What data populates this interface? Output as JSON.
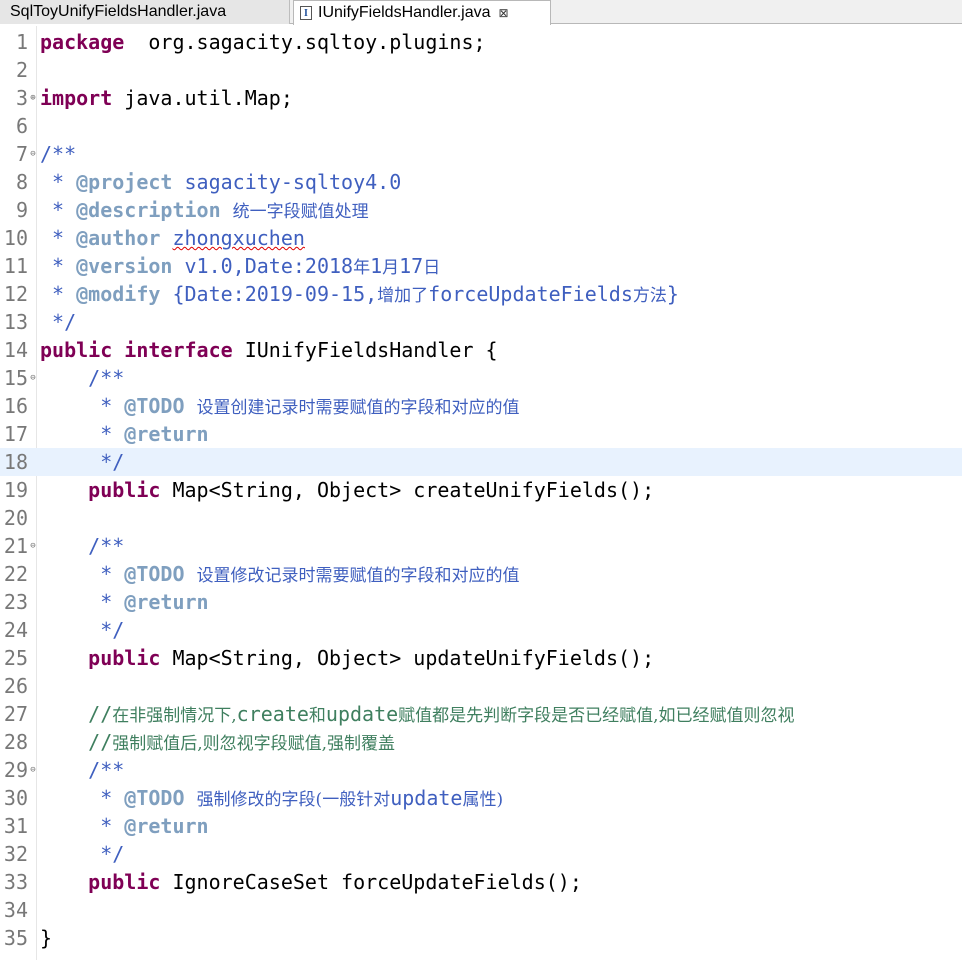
{
  "tabs": [
    {
      "label": "SqlToyUnifyFieldsHandler.java",
      "active": false
    },
    {
      "label": "IUnifyFieldsHandler.java",
      "active": true,
      "close_glyph": "⊠"
    }
  ],
  "editor": {
    "current_line": 18,
    "lines": [
      {
        "n": "1",
        "fold": "",
        "segs": [
          [
            "kw",
            "package"
          ],
          [
            "",
            "  org.sagacity.sqltoy.plugins;"
          ]
        ]
      },
      {
        "n": "2",
        "fold": "",
        "segs": []
      },
      {
        "n": "3",
        "fold": "⊕",
        "segs": [
          [
            "kw",
            "import"
          ],
          [
            "",
            " java.util.Map;"
          ]
        ]
      },
      {
        "n": "6",
        "fold": "",
        "segs": []
      },
      {
        "n": "7",
        "fold": "⊖",
        "segs": [
          [
            "jd",
            "/**"
          ]
        ]
      },
      {
        "n": "8",
        "fold": "",
        "segs": [
          [
            "jd",
            " * "
          ],
          [
            "tag",
            "@project"
          ],
          [
            "jd",
            " sagacity-sqltoy4.0"
          ]
        ]
      },
      {
        "n": "9",
        "fold": "",
        "segs": [
          [
            "jd",
            " * "
          ],
          [
            "tag",
            "@description"
          ],
          [
            "jd",
            " "
          ],
          [
            "jdzh",
            "统一字段赋值处理"
          ]
        ]
      },
      {
        "n": "10",
        "fold": "",
        "segs": [
          [
            "jd",
            " * "
          ],
          [
            "tag",
            "@author"
          ],
          [
            "jd",
            " "
          ],
          [
            "jdsq",
            "zhongxuchen"
          ]
        ]
      },
      {
        "n": "11",
        "fold": "",
        "segs": [
          [
            "jd",
            " * "
          ],
          [
            "tag",
            "@version"
          ],
          [
            "jd",
            " v1.0,Date:2018"
          ],
          [
            "jdzh",
            "年"
          ],
          [
            "jd",
            "1"
          ],
          [
            "jdzh",
            "月"
          ],
          [
            "jd",
            "17"
          ],
          [
            "jdzh",
            "日"
          ]
        ]
      },
      {
        "n": "12",
        "fold": "",
        "segs": [
          [
            "jd",
            " * "
          ],
          [
            "tag",
            "@modify"
          ],
          [
            "jd",
            " {Date:2019-09-15,"
          ],
          [
            "jdzh",
            "增加了"
          ],
          [
            "jd",
            "forceUpdateFields"
          ],
          [
            "jdzh",
            "方法"
          ],
          [
            "jd",
            "}"
          ]
        ]
      },
      {
        "n": "13",
        "fold": "",
        "segs": [
          [
            "jd",
            " */"
          ]
        ]
      },
      {
        "n": "14",
        "fold": "",
        "segs": [
          [
            "kw",
            "public"
          ],
          [
            "",
            " "
          ],
          [
            "kw",
            "interface"
          ],
          [
            "",
            " IUnifyFieldsHandler {"
          ]
        ]
      },
      {
        "n": "15",
        "fold": "⊖",
        "segs": [
          [
            "jd",
            "    /**"
          ]
        ]
      },
      {
        "n": "16",
        "fold": "",
        "segs": [
          [
            "jd",
            "     * "
          ],
          [
            "tag",
            "@TODO"
          ],
          [
            "jd",
            " "
          ],
          [
            "jdzh",
            "设置创建记录时需要赋值的字段和对应的值"
          ]
        ]
      },
      {
        "n": "17",
        "fold": "",
        "segs": [
          [
            "jd",
            "     * "
          ],
          [
            "tag",
            "@return"
          ]
        ]
      },
      {
        "n": "18",
        "fold": "",
        "segs": [
          [
            "jd",
            "     */"
          ]
        ]
      },
      {
        "n": "19",
        "fold": "",
        "segs": [
          [
            "",
            "    "
          ],
          [
            "kw",
            "public"
          ],
          [
            "",
            " Map<String, Object> createUnifyFields();"
          ]
        ]
      },
      {
        "n": "20",
        "fold": "",
        "segs": []
      },
      {
        "n": "21",
        "fold": "⊖",
        "segs": [
          [
            "jd",
            "    /**"
          ]
        ]
      },
      {
        "n": "22",
        "fold": "",
        "segs": [
          [
            "jd",
            "     * "
          ],
          [
            "tag",
            "@TODO"
          ],
          [
            "jd",
            " "
          ],
          [
            "jdzh",
            "设置修改记录时需要赋值的字段和对应的值"
          ]
        ]
      },
      {
        "n": "23",
        "fold": "",
        "segs": [
          [
            "jd",
            "     * "
          ],
          [
            "tag",
            "@return"
          ]
        ]
      },
      {
        "n": "24",
        "fold": "",
        "segs": [
          [
            "jd",
            "     */"
          ]
        ]
      },
      {
        "n": "25",
        "fold": "",
        "segs": [
          [
            "",
            "    "
          ],
          [
            "kw",
            "public"
          ],
          [
            "",
            " Map<String, Object> updateUnifyFields();"
          ]
        ]
      },
      {
        "n": "26",
        "fold": "",
        "segs": []
      },
      {
        "n": "27",
        "fold": "",
        "segs": [
          [
            "cmt",
            "    //"
          ],
          [
            "cmtzh",
            "在非强制情况下,"
          ],
          [
            "cmt",
            "create"
          ],
          [
            "cmtzh",
            "和"
          ],
          [
            "cmt",
            "update"
          ],
          [
            "cmtzh",
            "赋值都是先判断字段是否已经赋值,如已经赋值则忽视"
          ]
        ]
      },
      {
        "n": "28",
        "fold": "",
        "segs": [
          [
            "cmt",
            "    //"
          ],
          [
            "cmtzh",
            "强制赋值后,则忽视字段赋值,强制覆盖"
          ]
        ]
      },
      {
        "n": "29",
        "fold": "⊖",
        "segs": [
          [
            "jd",
            "    /**"
          ]
        ]
      },
      {
        "n": "30",
        "fold": "",
        "segs": [
          [
            "jd",
            "     * "
          ],
          [
            "tag",
            "@TODO"
          ],
          [
            "jd",
            " "
          ],
          [
            "jdzh",
            "强制修改的字段(一般针对"
          ],
          [
            "jd",
            "update"
          ],
          [
            "jdzh",
            "属性)"
          ]
        ]
      },
      {
        "n": "31",
        "fold": "",
        "segs": [
          [
            "jd",
            "     * "
          ],
          [
            "tag",
            "@return"
          ]
        ]
      },
      {
        "n": "32",
        "fold": "",
        "segs": [
          [
            "jd",
            "     */"
          ]
        ]
      },
      {
        "n": "33",
        "fold": "",
        "segs": [
          [
            "",
            "    "
          ],
          [
            "kw",
            "public"
          ],
          [
            "",
            " IgnoreCaseSet forceUpdateFields();"
          ]
        ]
      },
      {
        "n": "34",
        "fold": "",
        "segs": []
      },
      {
        "n": "35",
        "fold": "",
        "segs": [
          [
            "",
            "}"
          ]
        ]
      }
    ]
  }
}
